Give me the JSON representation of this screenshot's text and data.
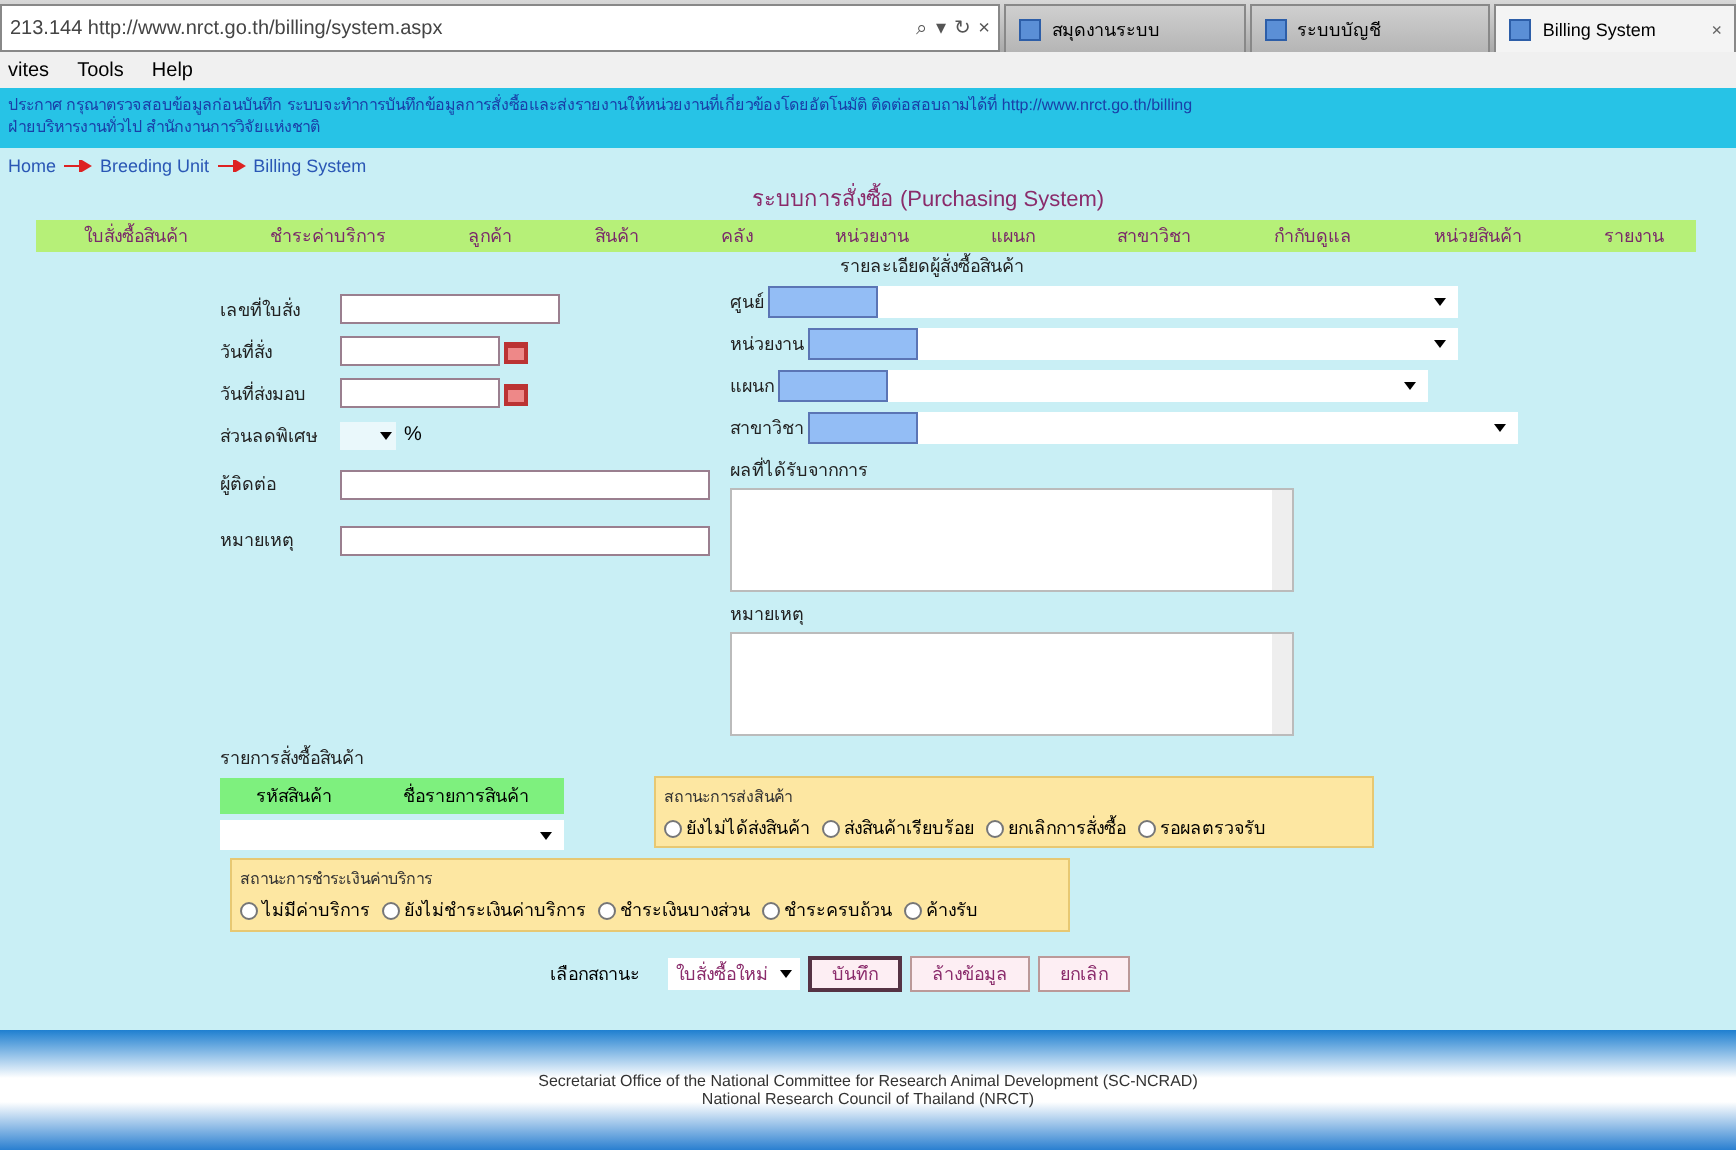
{
  "browser": {
    "address": "213.144 http://www.nrct.go.th/billing/system.aspx",
    "address_icons": [
      "⌕",
      "▾",
      "↻",
      "×"
    ],
    "tabs": [
      {
        "title": "สมุดงานระบบ",
        "selected": false
      },
      {
        "title": "ระบบบัญชี",
        "selected": false
      },
      {
        "title": "Billing System",
        "selected": true
      }
    ],
    "close": "×"
  },
  "menu": [
    "vites",
    "Tools",
    "Help"
  ],
  "banner": {
    "text": "ประกาศ กรุณาตรวจสอบข้อมูลก่อนบันทึก ระบบจะทำการบันทึกข้อมูลการสั่งซื้อและส่งรายงานให้หน่วยงานที่เกี่ยวข้องโดยอัตโนมัติ ติดต่อสอบถามได้ที่ http://www.nrct.go.th/billing",
    "line2": "ฝ่ายบริหารงานทั่วไป สำนักงานการวิจัยแห่งชาติ"
  },
  "breadcrumb": [
    {
      "label": "Home"
    },
    {
      "label": "Breeding Unit"
    },
    {
      "label": "Billing System"
    }
  ],
  "title": "ระบบการสั่งซื้อ (Purchasing System)",
  "nav": [
    "ใบสั่งซื้อสินค้า",
    "ชำระค่าบริการ",
    "ลูกค้า",
    "สินค้า",
    "คลัง",
    "หน่วยงาน",
    "แผนก",
    "สาขาวิชา",
    "กำกับดูแล",
    "หน่วยสินค้า",
    "รายงาน"
  ],
  "left_fields": [
    {
      "label": "เลขที่ใบสั่ง",
      "kind": "text"
    },
    {
      "label": "วันที่สั่ง",
      "kind": "date"
    },
    {
      "label": "วันที่ส่งมอบ",
      "kind": "date"
    },
    {
      "label": "ส่วนลดพิเศษ",
      "kind": "percent",
      "unit": "%"
    },
    {
      "label": "ผู้ติดต่อ",
      "kind": "wide"
    },
    {
      "label": "หมายเหตุ",
      "kind": "wide"
    }
  ],
  "orderer": {
    "heading": "รายละเอียดผู้สั่งซื้อสินค้า",
    "fields": [
      {
        "label": "ศูนย์"
      },
      {
        "label": "หน่วยงาน"
      },
      {
        "label": "แผนก"
      },
      {
        "label": "สาขาวิชา"
      }
    ],
    "notes": [
      {
        "label": "ผลที่ได้รับจากการ"
      },
      {
        "label": "หมายเหตุ"
      }
    ]
  },
  "items": {
    "heading": "รายการสั่งซื้อสินค้า",
    "columns": [
      "รหัสสินค้า",
      "ชื่อรายการสินค้า"
    ]
  },
  "delivery_status": {
    "heading": "สถานะการส่งสินค้า",
    "options": [
      {
        "label": "ยังไม่ได้ส่งสินค้า",
        "checked": false
      },
      {
        "label": "ส่งสินค้าเรียบร้อย",
        "checked": false
      },
      {
        "label": "ยกเลิกการสั่งซื้อ",
        "checked": false
      },
      {
        "label": "รอผลตรวจรับ",
        "checked": false
      }
    ]
  },
  "payment_status": {
    "heading": "สถานะการชำระเงินค่าบริการ",
    "options": [
      {
        "label": "ไม่มีค่าบริการ",
        "checked": false
      },
      {
        "label": "ยังไม่ชำระเงินค่าบริการ",
        "checked": false
      },
      {
        "label": "ชำระเงินบางส่วน",
        "checked": false
      },
      {
        "label": "ชำระครบถ้วน",
        "checked": false
      },
      {
        "label": "ค้างรับ",
        "checked": false
      }
    ]
  },
  "actions": {
    "label": "เลือกสถานะ",
    "status": "ใบสั่งซื้อใหม่",
    "buttons": [
      {
        "label": "บันทึก",
        "selected": true
      },
      {
        "label": "ล้างข้อมูล",
        "selected": false
      },
      {
        "label": "ยกเลิก",
        "selected": false
      }
    ]
  },
  "footer": [
    "Secretariat Office of the National Committee for Research Animal Development (SC-NCRAD)",
    "National Research Council of Thailand (NRCT)"
  ]
}
